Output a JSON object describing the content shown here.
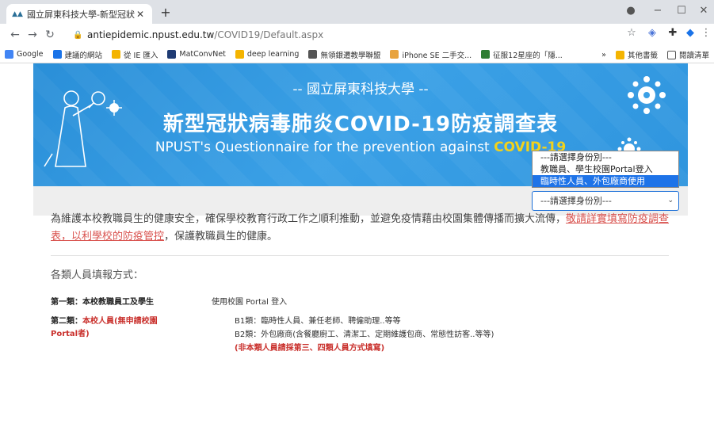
{
  "browser": {
    "tab_title": "國立屏東科技大學-新型冠狀病",
    "tab_close": "✕",
    "new_tab": "+",
    "window_controls": [
      "−",
      "☐",
      "✕"
    ],
    "url_domain": "antiepidemic.npust.edu.tw",
    "url_path": "/COVID19/Default.aspx",
    "bookmarks": [
      {
        "label": "Google",
        "icon": "google-icon",
        "color": "#4285f4"
      },
      {
        "label": "建議的網站",
        "icon": "bing-icon",
        "color": "#1a73e8"
      },
      {
        "label": "從 IE 匯入",
        "icon": "folder-icon",
        "color": "#f4b400"
      },
      {
        "label": "MatConvNet",
        "icon": "matconvnet-icon",
        "color": "#1f3b73"
      },
      {
        "label": "deep learning",
        "icon": "folder-icon",
        "color": "#f4b400"
      },
      {
        "label": "無領銀遷教學聯盟",
        "icon": "globe-icon",
        "color": "#555555"
      },
      {
        "label": "iPhone SE 二手交...",
        "icon": "ring-icon",
        "color": "#e8a33d"
      },
      {
        "label": "征服12星座的「隱...",
        "icon": "bh-icon",
        "color": "#2e7d32"
      }
    ],
    "bookmarks_overflow": "»",
    "other_bookmarks": "其他書籤",
    "reading_list": "閱讀清單"
  },
  "banner": {
    "top_line": "-- 國立屏東科技大學 --",
    "main_title": "新型冠狀病毒肺炎COVID-19防疫調查表",
    "english_prefix": "NPUST's Questionnaire for the prevention against ",
    "english_highlight": "COVID-19",
    "accent_color": "#f2d21b"
  },
  "identity_select": {
    "selected": "---請選擇身份別---",
    "options": [
      "---請選擇身份別---",
      "教職員、學生校園Portal登入",
      "臨時性人員、外包廠商使用"
    ],
    "highlighted_index": 2
  },
  "intro": {
    "text_plain": "為維護本校教職員生的健康安全，確保學校教育行政工作之順利推動，並避免疫情藉由校園集體傳播而擴大流傳，",
    "text_red": "敬請詳實填寫防疫調查表，以利學校的防疫管控",
    "text_end": "，保護教職員生的健康。"
  },
  "report_methods": {
    "title": "各類人員填報方式：",
    "cat1_label": "第一類：本校教職員工及學生",
    "cat1_desc": "使用校園 Portal 登入",
    "cat2_label_a": "第二類：",
    "cat2_label_b": "本校人員(無申請校園",
    "cat2_label_c": "Portal者)",
    "b1": "B1類：臨時性人員、兼任老師、聘僱助理..等等",
    "b2": "B2類：外包廠商(含餐廳廚工、清潔工、定期維護包商、常態性訪客..等等)",
    "note": "(非本類人員請採第三、四類人員方式填寫)"
  }
}
